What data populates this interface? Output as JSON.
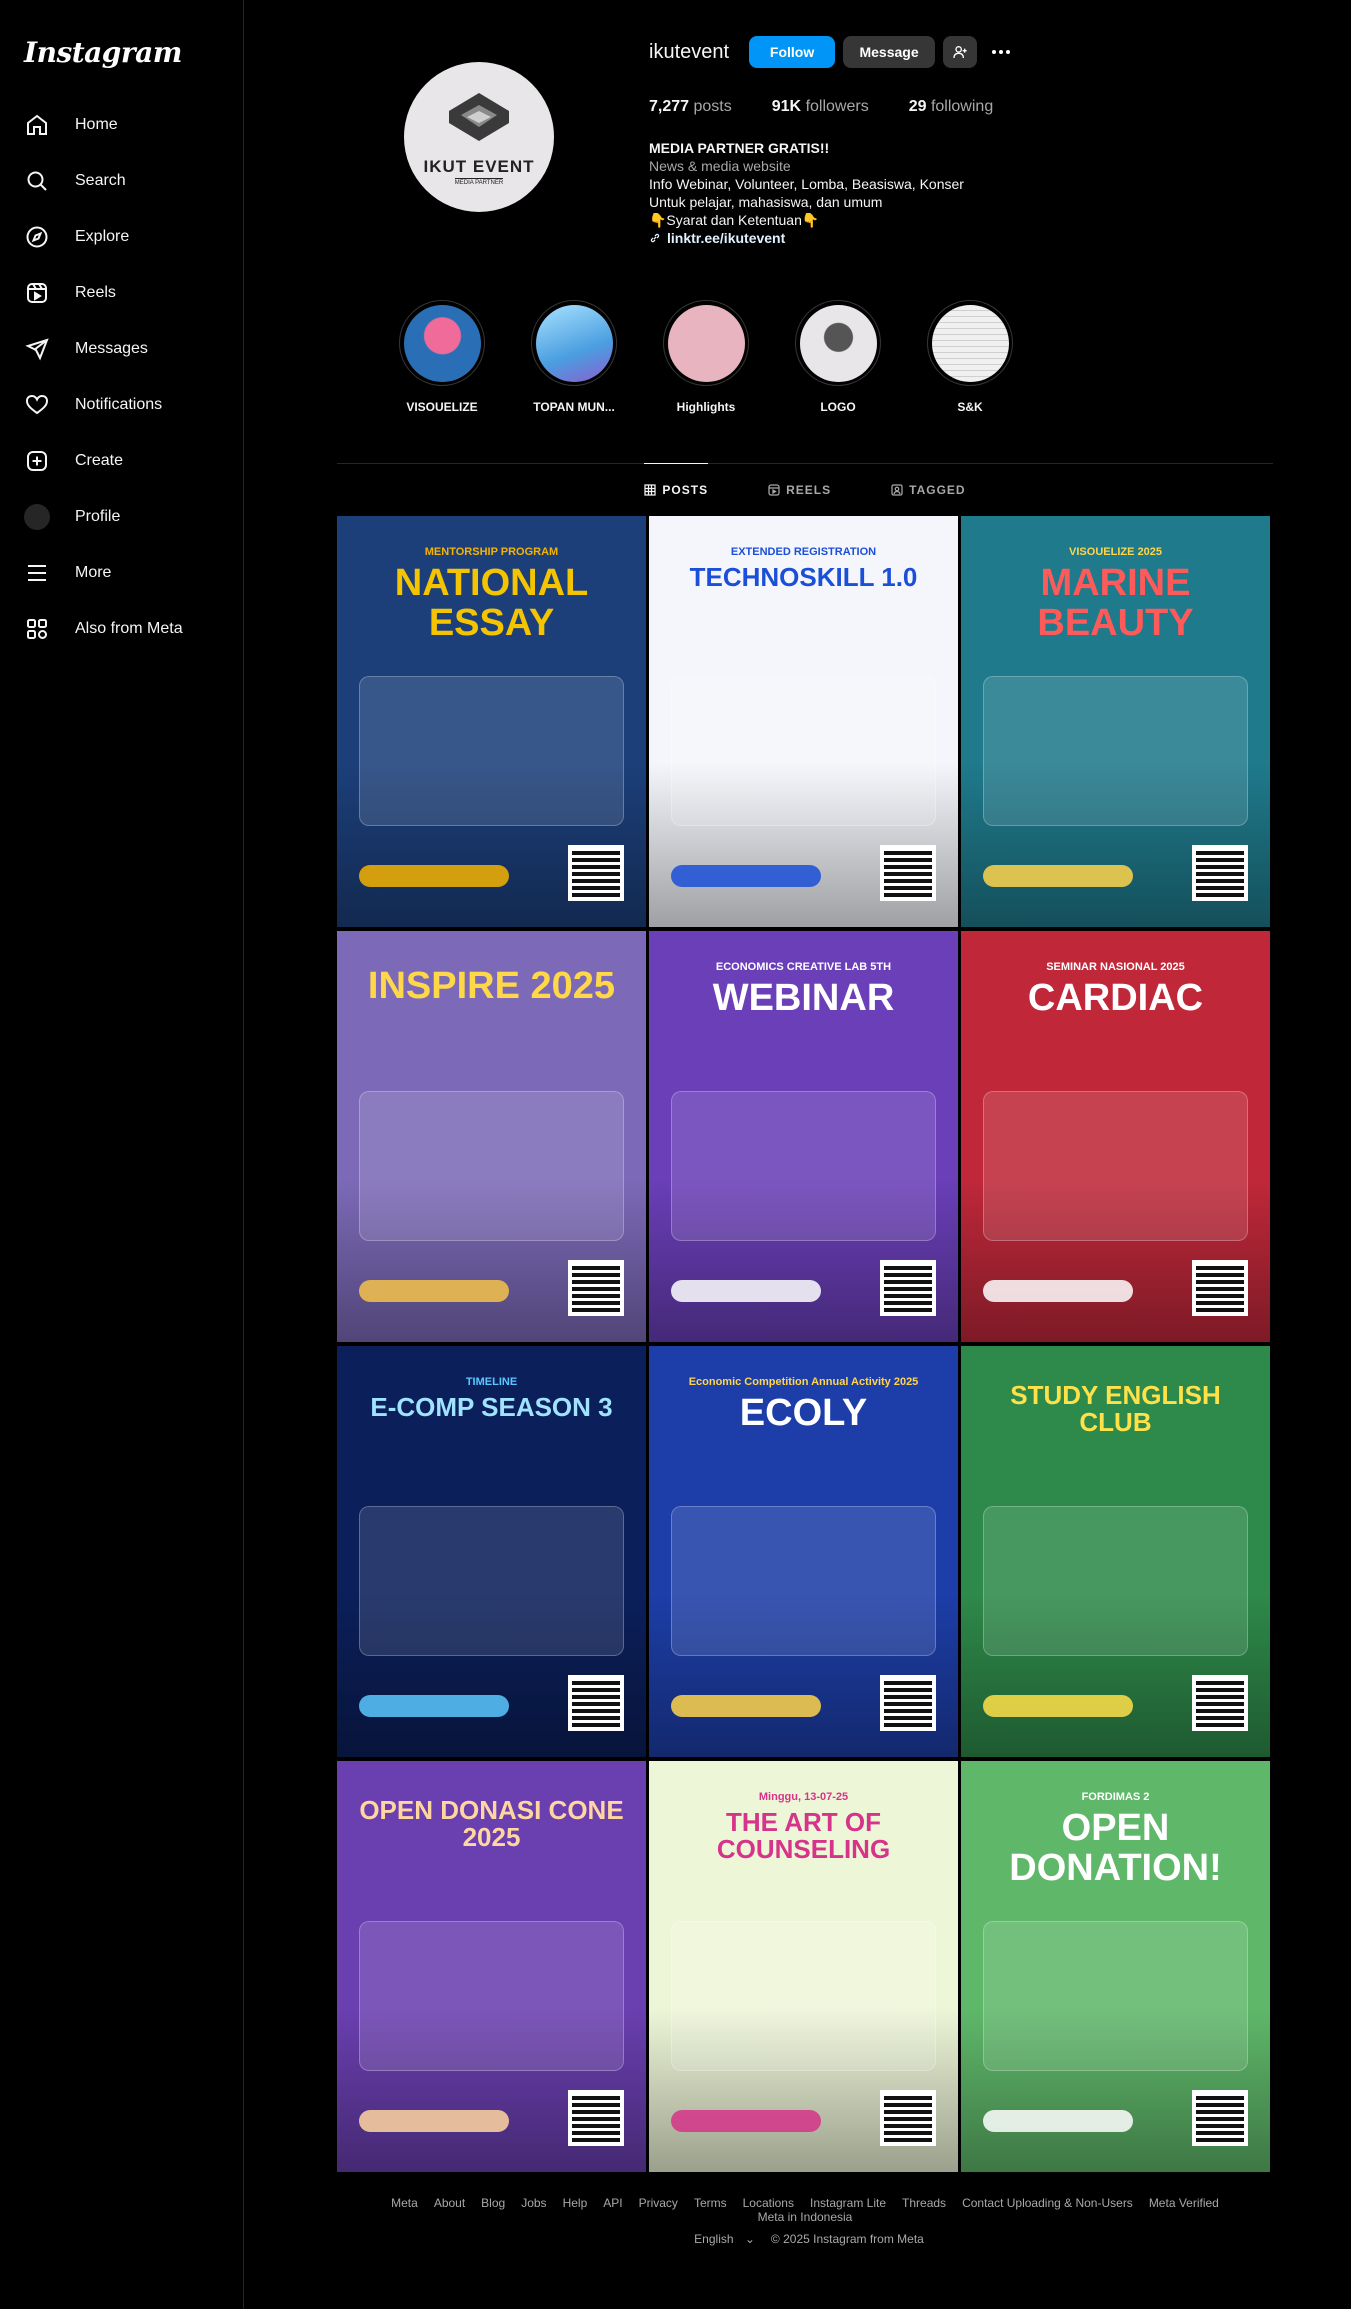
{
  "app": {
    "logo": "Instagram"
  },
  "nav": [
    {
      "label": "Home",
      "icon": "home-icon"
    },
    {
      "label": "Search",
      "icon": "search-icon"
    },
    {
      "label": "Explore",
      "icon": "compass-icon"
    },
    {
      "label": "Reels",
      "icon": "reels-icon"
    },
    {
      "label": "Messages",
      "icon": "send-icon"
    },
    {
      "label": "Notifications",
      "icon": "heart-icon"
    },
    {
      "label": "Create",
      "icon": "plus-square-icon"
    },
    {
      "label": "Profile",
      "icon": "avatar-icon"
    },
    {
      "label": "More",
      "icon": "menu-icon"
    },
    {
      "label": "Also from Meta",
      "icon": "meta-apps-icon"
    }
  ],
  "profile": {
    "username": "ikutevent",
    "pic_brand": "IKUT EVENT",
    "pic_sub": "MEDIA PARTNER",
    "follow_label": "Follow",
    "message_label": "Message",
    "posts_count": "7,277",
    "posts_label": "posts",
    "followers_count": "91K",
    "followers_label": "followers",
    "following_count": "29",
    "following_label": "following",
    "bio_name": "MEDIA PARTNER GRATIS!!",
    "bio_category": "News & media website",
    "bio_line1": "Info Webinar, Volunteer, Lomba, Beasiswa, Konser",
    "bio_line2": "Untuk pelajar, mahasiswa, dan umum",
    "bio_line3": "👇Syarat dan Ketentuan👇",
    "bio_link": "linktr.ee/ikutevent"
  },
  "highlights": [
    {
      "label": "VISOUELIZE",
      "color": "#2a6fb5"
    },
    {
      "label": "TOPAN MUN...",
      "color": "#4a9ee0"
    },
    {
      "label": "Highlights",
      "color": "#e8b4c0"
    },
    {
      "label": "LOGO",
      "color": "#e8e6e8"
    },
    {
      "label": "S&K",
      "color": "#f0f0f0"
    }
  ],
  "tabs": [
    {
      "label": "POSTS",
      "icon": "grid-icon"
    },
    {
      "label": "REELS",
      "icon": "reels-icon"
    },
    {
      "label": "TAGGED",
      "icon": "tag-icon"
    }
  ],
  "posts": [
    {
      "title": "NATIONAL ESSAY",
      "subtitle": "MENTORSHIP PROGRAM",
      "bg": "#1c3f7a",
      "accent": "#f5b300",
      "title_color": "#f5c400"
    },
    {
      "title": "TECHNOSKILL 1.0",
      "subtitle": "EXTENDED REGISTRATION",
      "bg": "#f4f6fb",
      "accent": "#1b4fd8",
      "title_color": "#1b4fd8"
    },
    {
      "title": "MARINE BEAUTY",
      "subtitle": "VISOUELIZE 2025",
      "bg": "#1f7a8c",
      "accent": "#ffd54a",
      "title_color": "#ff5a5a"
    },
    {
      "title": "INSPIRE 2025",
      "subtitle": "",
      "bg": "#7c6ab8",
      "accent": "#f4c24a",
      "title_color": "#ffd84a"
    },
    {
      "title": "WEBINAR",
      "subtitle": "ECONOMICS CREATIVE LAB 5TH",
      "bg": "#6a3fb8",
      "accent": "#ffffff",
      "title_color": "#ffffff"
    },
    {
      "title": "CARDIAC",
      "subtitle": "SEMINAR NASIONAL 2025",
      "bg": "#c0283a",
      "accent": "#ffffff",
      "title_color": "#ffffff"
    },
    {
      "title": "E-COMP SEASON 3",
      "subtitle": "TIMELINE",
      "bg": "#0b1f5a",
      "accent": "#5ac8ff",
      "title_color": "#9fe3ff"
    },
    {
      "title": "ECOLY",
      "subtitle": "Economic Competition Annual Activity 2025",
      "bg": "#1d3ea8",
      "accent": "#ffd54a",
      "title_color": "#ffffff"
    },
    {
      "title": "STUDY ENGLISH CLUB",
      "subtitle": "",
      "bg": "#2e8a4a",
      "accent": "#ffe14a",
      "title_color": "#ffe14a"
    },
    {
      "title": "OPEN DONASI CONE 2025",
      "subtitle": "",
      "bg": "#6a3fb0",
      "accent": "#ffd6a0",
      "title_color": "#ffd6a0"
    },
    {
      "title": "THE ART OF COUNSELING",
      "subtitle": "Minggu, 13-07-25",
      "bg": "#eef6d8",
      "accent": "#d6338a",
      "title_color": "#d6338a"
    },
    {
      "title": "OPEN DONATION!",
      "subtitle": "FORDIMAS 2",
      "bg": "#5fb86a",
      "accent": "#ffffff",
      "title_color": "#ffffff"
    }
  ],
  "footer": {
    "links": [
      "Meta",
      "About",
      "Blog",
      "Jobs",
      "Help",
      "API",
      "Privacy",
      "Terms",
      "Locations",
      "Instagram Lite",
      "Threads",
      "Contact Uploading & Non-Users",
      "Meta Verified",
      "Meta in Indonesia"
    ],
    "language": "English",
    "copyright": "© 2025 Instagram from Meta"
  }
}
